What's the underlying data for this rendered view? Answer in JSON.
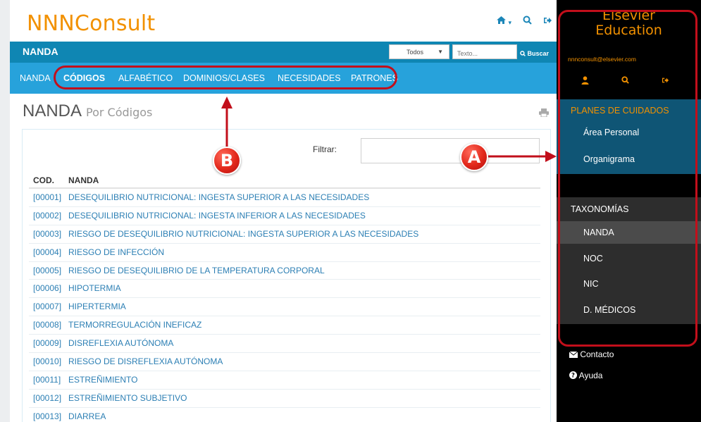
{
  "header": {
    "logo": "NNNConsult"
  },
  "topbar": {
    "title": "NANDA",
    "select_value": "Todos",
    "search_placeholder": "Texto...",
    "search_button": "Buscar"
  },
  "subnav": [
    "NANDA",
    "CÓDIGOS",
    "ALFABÉTICO",
    "DOMINIOS/CLASES",
    "NECESIDADES",
    "PATRONES"
  ],
  "page": {
    "title": "NANDA",
    "subtitle": "Por Códigos",
    "filter_label": "Filtrar:",
    "col_cod": "COD.",
    "col_nanda": "NANDA"
  },
  "rows": [
    {
      "code": "[00001]",
      "label": "DESEQUILIBRIO NUTRICIONAL: INGESTA SUPERIOR A LAS NECESIDADES"
    },
    {
      "code": "[00002]",
      "label": "DESEQUILIBRIO NUTRICIONAL: INGESTA INFERIOR A LAS NECESIDADES"
    },
    {
      "code": "[00003]",
      "label": "RIESGO DE DESEQUILIBRIO NUTRICIONAL: INGESTA SUPERIOR A LAS NECESIDADES"
    },
    {
      "code": "[00004]",
      "label": "RIESGO DE INFECCIÓN"
    },
    {
      "code": "[00005]",
      "label": "RIESGO DE DESEQUILIBRIO DE LA TEMPERATURA CORPORAL"
    },
    {
      "code": "[00006]",
      "label": "HIPOTERMIA"
    },
    {
      "code": "[00007]",
      "label": "HIPERTERMIA"
    },
    {
      "code": "[00008]",
      "label": "TERMORREGULACIÓN INEFICAZ"
    },
    {
      "code": "[00009]",
      "label": "DISREFLEXIA AUTÓNOMA"
    },
    {
      "code": "[00010]",
      "label": "RIESGO DE DISREFLEXIA AUTÓNOMA"
    },
    {
      "code": "[00011]",
      "label": "ESTREÑIMIENTO"
    },
    {
      "code": "[00012]",
      "label": "ESTREÑIMIENTO SUBJETIVO"
    },
    {
      "code": "[00013]",
      "label": "DIARREA"
    }
  ],
  "sidebar": {
    "brand_line1": "Elsevier",
    "brand_line2": "Education",
    "email": "nnnconsult@elsevier.com",
    "planes_title": "PLANES DE CUIDADOS",
    "planes_items": [
      "Área Personal",
      "Organigrama"
    ],
    "tax_title": "TAXONOMÍAS",
    "tax_items": [
      "NANDA",
      "NOC",
      "NIC",
      "D. MÉDICOS"
    ],
    "contact": "Contacto",
    "help": "Ayuda"
  },
  "callouts": {
    "a": "A",
    "b": "B"
  },
  "colors": {
    "brand_orange": "#f29100",
    "topbar_blue": "#0f86b3",
    "subnav_blue": "#27a2db",
    "callout_red": "#c20f1b"
  }
}
